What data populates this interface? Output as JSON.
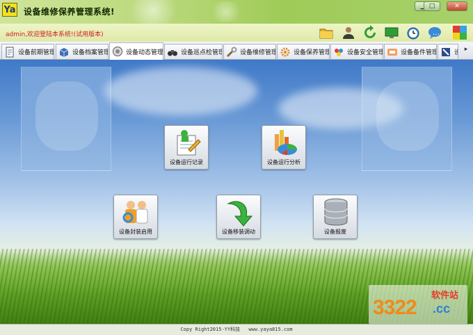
{
  "app": {
    "logo": "Ya",
    "title": "设备维修保养管理系统!"
  },
  "window_controls": [
    "minimize-icon",
    "maximize-icon",
    "close-icon"
  ],
  "welcome": "admin,欢迎登陆本系统!(试用版本)",
  "toolbar": [
    "folder-icon",
    "user-icon",
    "refresh-icon",
    "monitor-icon",
    "clock-icon",
    "help-icon",
    "color-palette-icon"
  ],
  "tabs": [
    {
      "label": "设备前期管理",
      "icon": "document-icon"
    },
    {
      "label": "设备档案管理",
      "icon": "box-icon"
    },
    {
      "label": "设备动态管理",
      "icon": "dial-icon"
    },
    {
      "label": "设备巡点检管理",
      "icon": "binoculars-icon"
    },
    {
      "label": "设备维修管理",
      "icon": "wrench-icon"
    },
    {
      "label": "设备保养管理",
      "icon": "gear-icon"
    },
    {
      "label": "设备安全管理",
      "icon": "shield-icon"
    },
    {
      "label": "设备备件管理",
      "icon": "parts-icon"
    },
    {
      "label": "设",
      "icon": "more-icon"
    }
  ],
  "active_tab": "设备动态管理",
  "tiles": [
    {
      "label": "设备运行记录",
      "icon": "record-icon"
    },
    {
      "label": "设备运行分析",
      "icon": "pie-chart-icon"
    },
    {
      "label": "设备封装启用",
      "icon": "workers-icon"
    },
    {
      "label": "设备移装调动",
      "icon": "green-arrow-icon"
    },
    {
      "label": "设备报废",
      "icon": "database-icon"
    }
  ],
  "footer": {
    "copyright": "Copy Right2015-YY科技",
    "website": "www.yaya815.com"
  },
  "watermark": {
    "number": "3322",
    "site_cn": "软件站",
    "suffix": ".cc"
  },
  "colors": {
    "welcome_text": "#d21c1c",
    "title_bar": "#b9d87a",
    "desktop_sky": "#3f79c8",
    "grass": "#5f9f25"
  }
}
